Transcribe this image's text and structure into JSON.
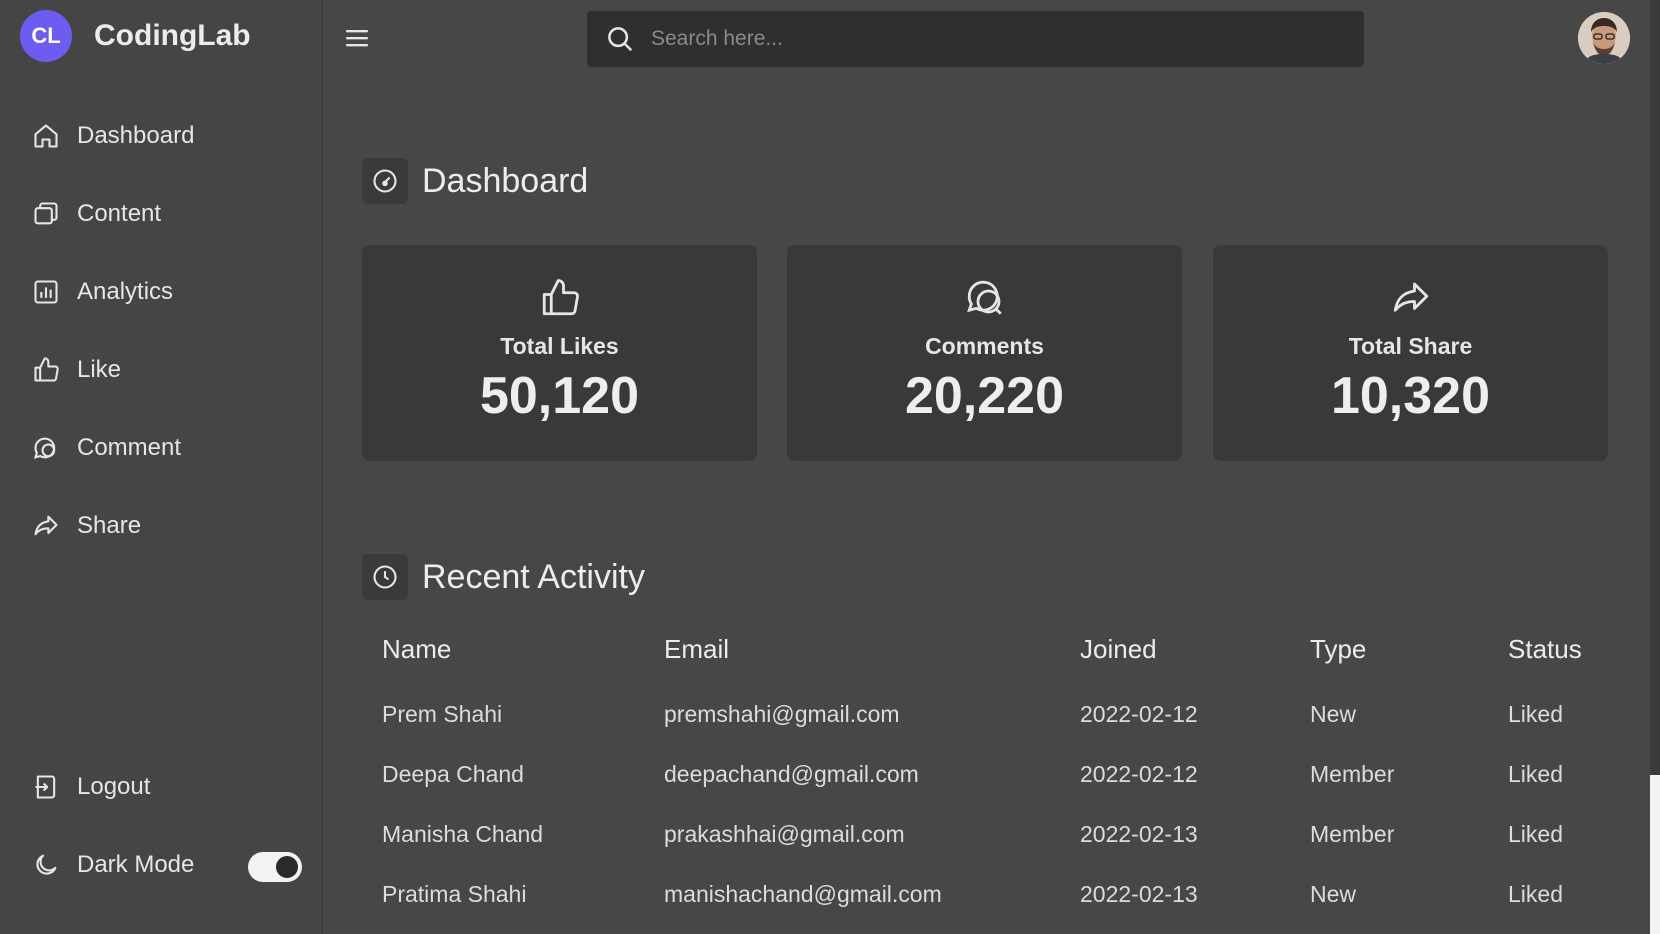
{
  "brand": {
    "logo_text": "CL",
    "name": "CodingLab"
  },
  "sidebar": {
    "items": [
      {
        "label": "Dashboard",
        "icon": "home-icon"
      },
      {
        "label": "Content",
        "icon": "files-icon"
      },
      {
        "label": "Analytics",
        "icon": "bar-chart-icon"
      },
      {
        "label": "Like",
        "icon": "thumbs-up-icon"
      },
      {
        "label": "Comment",
        "icon": "comment-icon"
      },
      {
        "label": "Share",
        "icon": "share-icon"
      }
    ],
    "logout_label": "Logout",
    "dark_mode_label": "Dark Mode",
    "dark_mode_on": true
  },
  "search": {
    "placeholder": "Search here..."
  },
  "dashboard": {
    "title": "Dashboard",
    "cards": [
      {
        "label": "Total Likes",
        "value": "50,120",
        "icon": "thumbs-up-icon"
      },
      {
        "label": "Comments",
        "value": "20,220",
        "icon": "comments-icon"
      },
      {
        "label": "Total Share",
        "value": "10,320",
        "icon": "share-icon"
      }
    ]
  },
  "activity": {
    "title": "Recent Activity",
    "headers": [
      "Name",
      "Email",
      "Joined",
      "Type",
      "Status"
    ],
    "rows": [
      [
        "Prem Shahi",
        "premshahi@gmail.com",
        "2022-02-12",
        "New",
        "Liked"
      ],
      [
        "Deepa Chand",
        "deepachand@gmail.com",
        "2022-02-12",
        "Member",
        "Liked"
      ],
      [
        "Manisha Chand",
        "prakashhai@gmail.com",
        "2022-02-13",
        "Member",
        "Liked"
      ],
      [
        "Pratima Shahi",
        "manishachand@gmail.com",
        "2022-02-13",
        "New",
        "Liked"
      ]
    ]
  },
  "colors": {
    "accent": "#6d5cf0",
    "background": "#474747",
    "card": "#393939"
  }
}
